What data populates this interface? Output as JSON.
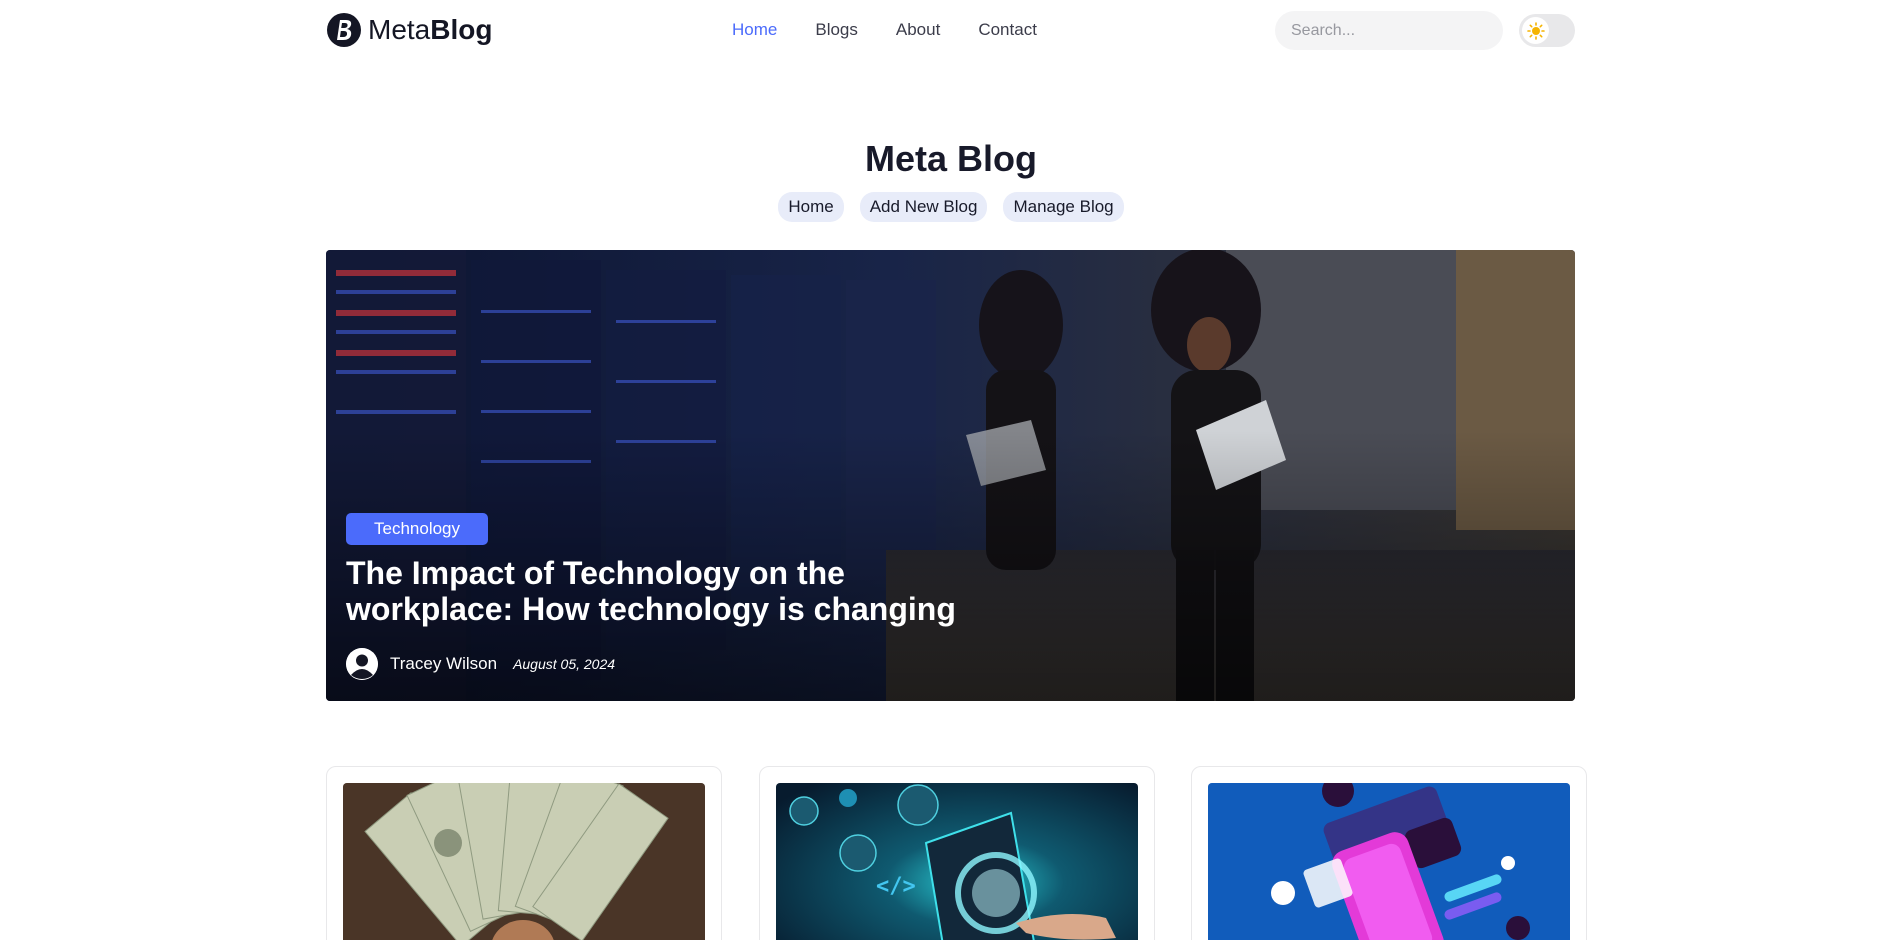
{
  "header": {
    "logo": {
      "light": "Meta",
      "bold": "Blog"
    },
    "nav": [
      {
        "label": "Home",
        "active": true
      },
      {
        "label": "Blogs",
        "active": false
      },
      {
        "label": "About",
        "active": false
      },
      {
        "label": "Contact",
        "active": false
      }
    ],
    "search": {
      "placeholder": "Search..."
    },
    "theme_toggle": {
      "icon": "sun-icon",
      "state": "light"
    }
  },
  "page": {
    "title": "Meta Blog",
    "breadcrumbs": [
      "Home",
      "Add New Blog",
      "Manage Blog"
    ]
  },
  "hero": {
    "category": "Technology",
    "title": "The Impact of Technology on the workplace: How technology is changing",
    "author": "Tracey Wilson",
    "date": "August 05, 2024"
  },
  "cards": [
    {
      "image": "money-fan-image"
    },
    {
      "image": "web-development-image"
    },
    {
      "image": "ui-ux-phone-image"
    }
  ],
  "colors": {
    "accent": "#4b6bfb",
    "text": "#181a2a",
    "nav_text": "#3b3c4a",
    "crumb_bg": "#e8ecf9"
  }
}
